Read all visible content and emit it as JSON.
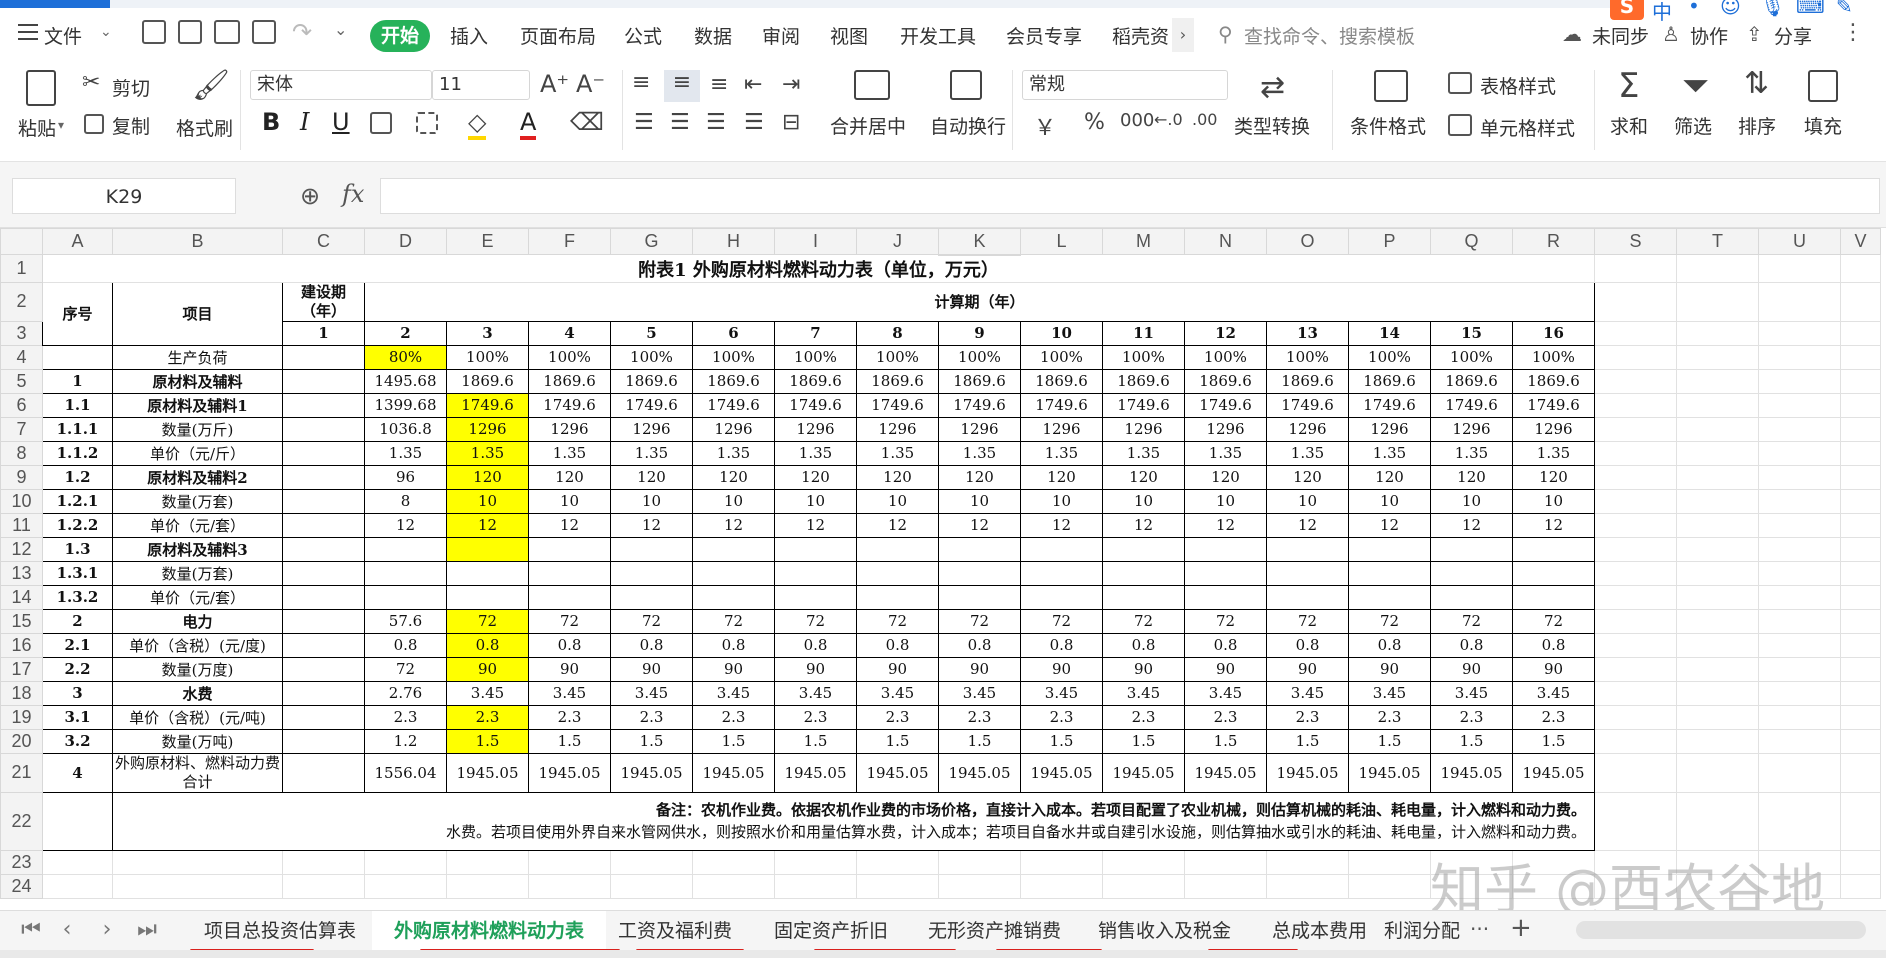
{
  "menu": {
    "file": "文件",
    "tabs": [
      "开始",
      "插入",
      "页面布局",
      "公式",
      "数据",
      "审阅",
      "视图",
      "开发工具",
      "会员专享",
      "稻壳资"
    ],
    "search_placeholder": "查找命令、搜索模板",
    "sync": "未同步",
    "collab": "协作",
    "share": "分享",
    "ime_text": "中"
  },
  "ribbon": {
    "paste": "粘贴",
    "cut": "剪切",
    "copy": "复制",
    "format_painter": "格式刷",
    "font_name": "宋体",
    "font_size": "11",
    "merge_center": "合并居中",
    "wrap_text": "自动换行",
    "number_format": "常规",
    "type_convert": "类型转换",
    "cond_format": "条件格式",
    "table_style": "表格样式",
    "cell_style": "单元格样式",
    "sum": "求和",
    "filter": "筛选",
    "sort": "排序",
    "fill": "填充",
    "currency": "￥",
    "percent": "%",
    "thousands": "000"
  },
  "formula_bar": {
    "name_box": "K29",
    "fx": "fx",
    "content": ""
  },
  "grid": {
    "columns": [
      "A",
      "B",
      "C",
      "D",
      "E",
      "F",
      "G",
      "H",
      "I",
      "J",
      "K",
      "L",
      "M",
      "N",
      "O",
      "P",
      "Q",
      "R",
      "S",
      "T",
      "U",
      "V"
    ],
    "selected_column": "K",
    "title": "附表1  外购原材料燃料动力表（单位，万元）",
    "hdr_seq": "序号",
    "hdr_item": "项目",
    "hdr_construction": "建设期（年）",
    "hdr_calc_period": "计算期（年）",
    "year_construction": "1",
    "years": [
      "2",
      "3",
      "4",
      "5",
      "6",
      "7",
      "8",
      "9",
      "10",
      "11",
      "12",
      "13",
      "14",
      "15",
      "16"
    ],
    "rows": [
      {
        "n": "4",
        "seq": "",
        "item": "生产负荷",
        "bold": false,
        "c": "",
        "vals": [
          "80%",
          "100%",
          "100%",
          "100%",
          "100%",
          "100%",
          "100%",
          "100%",
          "100%",
          "100%",
          "100%",
          "100%",
          "100%",
          "100%",
          "100%"
        ]
      },
      {
        "n": "5",
        "seq": "1",
        "item": "原材料及辅料",
        "bold": true,
        "c": "",
        "vals": [
          "1495.68",
          "1869.6",
          "1869.6",
          "1869.6",
          "1869.6",
          "1869.6",
          "1869.6",
          "1869.6",
          "1869.6",
          "1869.6",
          "1869.6",
          "1869.6",
          "1869.6",
          "1869.6",
          "1869.6"
        ]
      },
      {
        "n": "6",
        "seq": "1.1",
        "item": "原材料及辅料1",
        "bold": true,
        "c": "",
        "vals": [
          "1399.68",
          "1749.6",
          "1749.6",
          "1749.6",
          "1749.6",
          "1749.6",
          "1749.6",
          "1749.6",
          "1749.6",
          "1749.6",
          "1749.6",
          "1749.6",
          "1749.6",
          "1749.6",
          "1749.6"
        ]
      },
      {
        "n": "7",
        "seq": "1.1.1",
        "item": "数量(万斤)",
        "bold": false,
        "c": "",
        "vals": [
          "1036.8",
          "1296",
          "1296",
          "1296",
          "1296",
          "1296",
          "1296",
          "1296",
          "1296",
          "1296",
          "1296",
          "1296",
          "1296",
          "1296",
          "1296"
        ]
      },
      {
        "n": "8",
        "seq": "1.1.2",
        "item": "单价（元/斤）",
        "bold": false,
        "c": "",
        "vals": [
          "1.35",
          "1.35",
          "1.35",
          "1.35",
          "1.35",
          "1.35",
          "1.35",
          "1.35",
          "1.35",
          "1.35",
          "1.35",
          "1.35",
          "1.35",
          "1.35",
          "1.35"
        ]
      },
      {
        "n": "9",
        "seq": "1.2",
        "item": "原材料及辅料2",
        "bold": true,
        "c": "",
        "vals": [
          "96",
          "120",
          "120",
          "120",
          "120",
          "120",
          "120",
          "120",
          "120",
          "120",
          "120",
          "120",
          "120",
          "120",
          "120"
        ]
      },
      {
        "n": "10",
        "seq": "1.2.1",
        "item": "数量(万套)",
        "bold": false,
        "c": "",
        "vals": [
          "8",
          "10",
          "10",
          "10",
          "10",
          "10",
          "10",
          "10",
          "10",
          "10",
          "10",
          "10",
          "10",
          "10",
          "10"
        ]
      },
      {
        "n": "11",
        "seq": "1.2.2",
        "item": "单价（元/套）",
        "bold": false,
        "c": "",
        "vals": [
          "12",
          "12",
          "12",
          "12",
          "12",
          "12",
          "12",
          "12",
          "12",
          "12",
          "12",
          "12",
          "12",
          "12",
          "12"
        ]
      },
      {
        "n": "12",
        "seq": "1.3",
        "item": "原材料及辅料3",
        "bold": true,
        "c": "",
        "vals": [
          "",
          "",
          "",
          "",
          "",
          "",
          "",
          "",
          "",
          "",
          "",
          "",
          "",
          "",
          ""
        ]
      },
      {
        "n": "13",
        "seq": "1.3.1",
        "item": "数量(万套)",
        "bold": false,
        "c": "",
        "vals": [
          "",
          "",
          "",
          "",
          "",
          "",
          "",
          "",
          "",
          "",
          "",
          "",
          "",
          "",
          ""
        ]
      },
      {
        "n": "14",
        "seq": "1.3.2",
        "item": "单价（元/套）",
        "bold": false,
        "c": "",
        "vals": [
          "",
          "",
          "",
          "",
          "",
          "",
          "",
          "",
          "",
          "",
          "",
          "",
          "",
          "",
          ""
        ]
      },
      {
        "n": "15",
        "seq": "2",
        "item": "电力",
        "bold": true,
        "c": "",
        "vals": [
          "57.6",
          "72",
          "72",
          "72",
          "72",
          "72",
          "72",
          "72",
          "72",
          "72",
          "72",
          "72",
          "72",
          "72",
          "72"
        ]
      },
      {
        "n": "16",
        "seq": "2.1",
        "item": "单价（含税）(元/度)",
        "bold": false,
        "c": "",
        "vals": [
          "0.8",
          "0.8",
          "0.8",
          "0.8",
          "0.8",
          "0.8",
          "0.8",
          "0.8",
          "0.8",
          "0.8",
          "0.8",
          "0.8",
          "0.8",
          "0.8",
          "0.8"
        ]
      },
      {
        "n": "17",
        "seq": "2.2",
        "item": "数量(万度)",
        "bold": false,
        "c": "",
        "vals": [
          "72",
          "90",
          "90",
          "90",
          "90",
          "90",
          "90",
          "90",
          "90",
          "90",
          "90",
          "90",
          "90",
          "90",
          "90"
        ]
      },
      {
        "n": "18",
        "seq": "3",
        "item": "水费",
        "bold": true,
        "c": "",
        "vals": [
          "2.76",
          "3.45",
          "3.45",
          "3.45",
          "3.45",
          "3.45",
          "3.45",
          "3.45",
          "3.45",
          "3.45",
          "3.45",
          "3.45",
          "3.45",
          "3.45",
          "3.45"
        ]
      },
      {
        "n": "19",
        "seq": "3.1",
        "item": "单价（含税）(元/吨)",
        "bold": false,
        "c": "",
        "vals": [
          "2.3",
          "2.3",
          "2.3",
          "2.3",
          "2.3",
          "2.3",
          "2.3",
          "2.3",
          "2.3",
          "2.3",
          "2.3",
          "2.3",
          "2.3",
          "2.3",
          "2.3"
        ]
      },
      {
        "n": "20",
        "seq": "3.2",
        "item": "数量(万吨)",
        "bold": false,
        "c": "",
        "vals": [
          "1.2",
          "1.5",
          "1.5",
          "1.5",
          "1.5",
          "1.5",
          "1.5",
          "1.5",
          "1.5",
          "1.5",
          "1.5",
          "1.5",
          "1.5",
          "1.5",
          "1.5"
        ]
      },
      {
        "n": "21",
        "seq": "4",
        "item": "外购原材料、燃料动力费合计",
        "bold": false,
        "c": "",
        "vals": [
          "1556.04",
          "1945.05",
          "1945.05",
          "1945.05",
          "1945.05",
          "1945.05",
          "1945.05",
          "1945.05",
          "1945.05",
          "1945.05",
          "1945.05",
          "1945.05",
          "1945.05",
          "1945.05",
          "1945.05"
        ]
      }
    ],
    "yellow_rows_d": [
      "4"
    ],
    "yellow_rows_e": [
      "6",
      "7",
      "8",
      "9",
      "10",
      "11",
      "12",
      "15",
      "16",
      "17",
      "19",
      "20"
    ],
    "note_line1": "备注：农机作业费。依据农机作业费的市场价格，直接计入成本。若项目配置了农业机械，则估算机械的耗油、耗电量，计入燃料和动力费。",
    "note_line2": "水费。若项目使用外界自来水管网供水，则按照水价和用量估算水费，计入成本；若项目自备水井或自建引水设施，则估算抽水或引水的耗油、耗电量，计入燃料和动力费。",
    "empty_rows": [
      "23",
      "24"
    ]
  },
  "sheet_tabs": [
    "项目总投资估算表",
    "外购原材料燃料动力表",
    "工资及福利费",
    "固定资产折旧",
    "无形资产摊销费",
    "销售收入及税金",
    "总成本费用",
    "利润分配"
  ],
  "active_sheet": "外购原材料燃料动力表",
  "more_tabs": "···",
  "add_tab": "+",
  "watermark": "知乎 @西农谷地",
  "colors": {
    "accent_green": "#26b25a",
    "highlight_yellow": "#ffff00",
    "annotation_red": "#d9201c"
  }
}
